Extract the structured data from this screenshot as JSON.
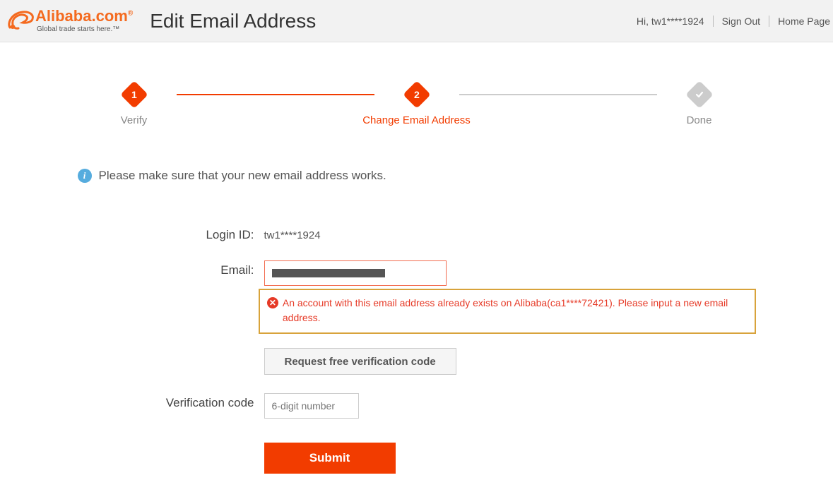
{
  "header": {
    "logo_main": "Alibaba",
    "logo_com": ".com",
    "logo_r": "®",
    "logo_tagline": "Global trade starts here.™",
    "page_title": "Edit Email Address",
    "greeting": "Hi, tw1****1924",
    "sign_out": "Sign Out",
    "home_page": "Home Page"
  },
  "stepper": {
    "step1_num": "1",
    "step1_label": "Verify",
    "step2_num": "2",
    "step2_label": "Change Email Address",
    "step3_label": "Done"
  },
  "info_note": "Please make sure that your new email address works.",
  "form": {
    "login_id_label": "Login ID:",
    "login_id_value": "tw1****1924",
    "email_label": "Email:",
    "error_message": "An account with this email address already exists on Alibaba(ca1****72421). Please input a new email address.",
    "request_code_btn": "Request free verification code",
    "verification_label": "Verification code",
    "verification_placeholder": "6-digit number",
    "submit_btn": "Submit"
  }
}
